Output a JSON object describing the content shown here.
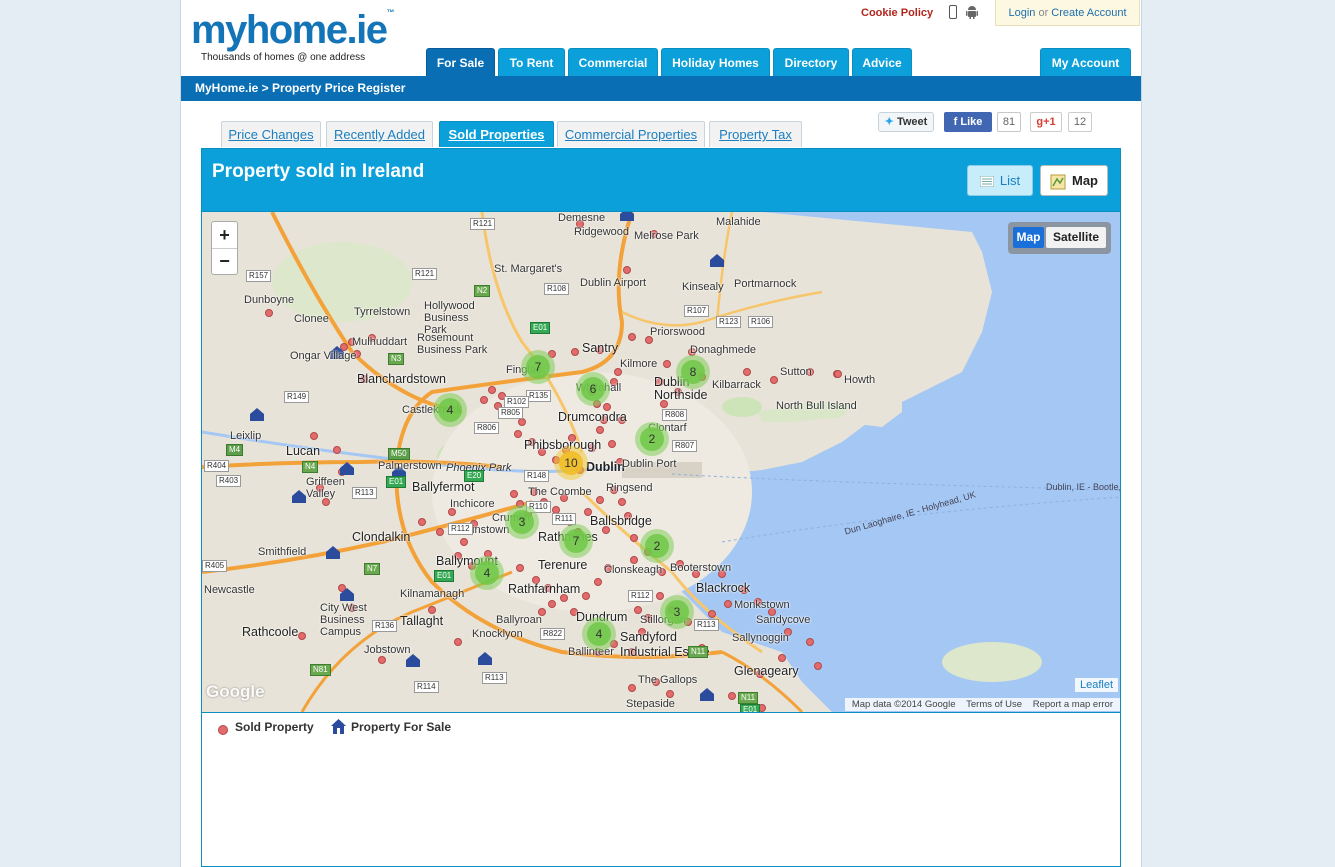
{
  "header": {
    "logo_text": "myhome.ie",
    "logo_tld_mark": "™",
    "tagline": "Thousands of homes @ one address",
    "cookie_policy": "Cookie Policy",
    "login": "Login",
    "or": "or",
    "create_account": "Create Account"
  },
  "nav": {
    "tabs": [
      {
        "label": "For Sale"
      },
      {
        "label": "To Rent"
      },
      {
        "label": "Commercial"
      },
      {
        "label": "Holiday Homes"
      },
      {
        "label": "Directory"
      },
      {
        "label": "Advice"
      }
    ],
    "account": "My Account"
  },
  "breadcrumb": "MyHome.ie > Property Price Register",
  "sub_tabs": [
    {
      "label": "Price Changes"
    },
    {
      "label": "Recently Added"
    },
    {
      "label": "Sold Properties"
    },
    {
      "label": "Commercial Properties"
    },
    {
      "label": "Property Tax"
    }
  ],
  "social": {
    "tweet": "Tweet",
    "like": "Like",
    "like_count": "81",
    "gplus": "+1",
    "gplus_count": "12"
  },
  "panel": {
    "title": "Property sold in Ireland",
    "list_btn": "List",
    "map_btn": "Map"
  },
  "map": {
    "zoom_in": "+",
    "zoom_out": "−",
    "layer_map": "Map",
    "layer_satellite": "Satellite",
    "leaflet": "Leaflet",
    "attribution": [
      "Map data ©2014 Google",
      "Terms of Use",
      "Report a map error"
    ],
    "google": "Google",
    "places": [
      "Demesne",
      "Malahide",
      "Ridgewood",
      "Melrose Park",
      "St. Margaret's",
      "Dublin Airport",
      "Kinsealy",
      "Portmarnock",
      "Dunboyne",
      "Clonee",
      "Tyrrelstown",
      "Hollywood Business Park",
      "Rosemount Business Park",
      "Santry",
      "Priorswood",
      "Donaghmede",
      "Ongar Village",
      "Mulhuddart",
      "Kilmore",
      "Blanchardstown",
      "Finglas",
      "Whitehall",
      "Kilbarrack",
      "Sutton",
      "Howth",
      "Dublin Northside",
      "North Bull Island",
      "Castleknock",
      "Drumcondra",
      "Clontarf",
      "Leixlip",
      "Phibsborough",
      "Lucan",
      "Palmerstown",
      "Phoenix Park",
      "Dublin",
      "Dublin Port",
      "Griffeen Valley",
      "Ballyfermot",
      "The Coombe",
      "Ringsend",
      "Inchicore",
      "Crumlin",
      "Ballsbridge",
      "Clondalkin",
      "Walkinstown",
      "Rathmines",
      "Smithfield",
      "Ballymount",
      "Terenure",
      "Clonskeagh",
      "Booterstown",
      "Newcastle",
      "Kilnamanagh",
      "Rathfarnham",
      "Blackrock",
      "Monkstown",
      "City West Business Campus",
      "Tallaght",
      "Knocklyon",
      "Ballyroan",
      "Dundrum",
      "Stillorgan",
      "Sandycove",
      "Rathcoole",
      "Sandyford Industrial Estate",
      "Sallynoggin",
      "Jobstown",
      "Ballinteer",
      "Glenageary",
      "The Gallops",
      "Stepaside"
    ],
    "ferry_routes": [
      "Dun Laoghaire, IE - Holyhead, UK",
      "Dublin, IE - Bootle,"
    ],
    "roads": [
      "R121",
      "R121",
      "R157",
      "R108",
      "N2",
      "R107",
      "R123",
      "R106",
      "E01",
      "N3",
      "R135",
      "R149",
      "R805",
      "R102",
      "R806",
      "R808",
      "M50",
      "R807",
      "M4",
      "N4",
      "R404",
      "R403",
      "R148",
      "R113",
      "E01",
      "E20",
      "R110",
      "R111",
      "R112",
      "R405",
      "N7",
      "E01",
      "R136",
      "R112",
      "R822",
      "R113",
      "N11",
      "N81",
      "R113",
      "R114",
      "N11",
      "E01"
    ],
    "clusters": [
      "4",
      "7",
      "6",
      "8",
      "2",
      "10",
      "3",
      "7",
      "2",
      "4",
      "3",
      "4"
    ]
  },
  "legend": {
    "sold": "Sold Property",
    "for_sale": "Property For Sale"
  }
}
